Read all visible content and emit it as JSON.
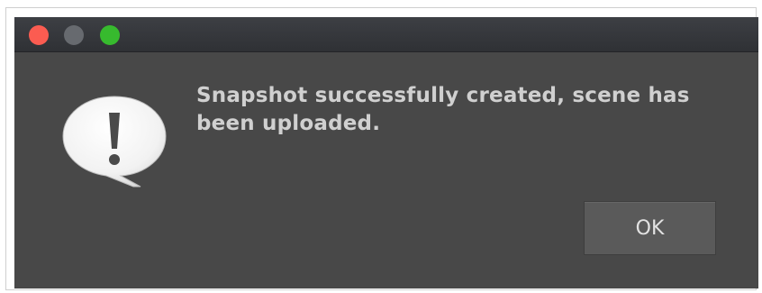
{
  "window": {
    "controls": [
      {
        "name": "close",
        "color": "#fb5c51"
      },
      {
        "name": "minimize",
        "color": "#676a6f"
      },
      {
        "name": "zoom",
        "color": "#37ba2e"
      }
    ]
  },
  "dialog": {
    "icon": "alert-speech-bubble-icon",
    "message": "Snapshot successfully created, scene has been uploaded.",
    "ok_label": "OK"
  }
}
